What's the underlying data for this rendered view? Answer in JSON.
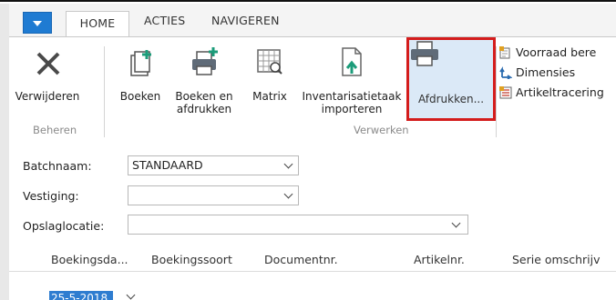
{
  "ribbon": {
    "tabs": [
      "HOME",
      "ACTIES",
      "NAVIGEREN"
    ],
    "groups": {
      "beheren": "Beheren",
      "verwerken": "Verwerken"
    },
    "buttons": {
      "verwijderen": "Verwijderen",
      "boeken": "Boeken",
      "boeken_afdrukken": "Boeken en\nafdrukken",
      "matrix": "Matrix",
      "inventarisatie": "Inventarisatietaak\nimporteren",
      "afdrukken": "Afdrukken..."
    },
    "small_actions": [
      "Voorraad bere",
      "Dimensies",
      "Artikeltracering"
    ]
  },
  "form": {
    "batchnaam_label": "Batchnaam:",
    "batchnaam_value": "STANDAARD",
    "vestiging_label": "Vestiging:",
    "vestiging_value": "",
    "opslaglocatie_label": "Opslaglocatie:",
    "opslaglocatie_value": ""
  },
  "grid": {
    "columns": [
      "Boekingsda...",
      "Boekingssoort",
      "Documentnr.",
      "Artikelnr.",
      "Serie omschrijv"
    ],
    "row_date": "25-5-2018"
  },
  "colors": {
    "accent": "#1f7bd2",
    "highlight_border": "#d41c1c",
    "selected_cell": "#2f7dd0"
  }
}
